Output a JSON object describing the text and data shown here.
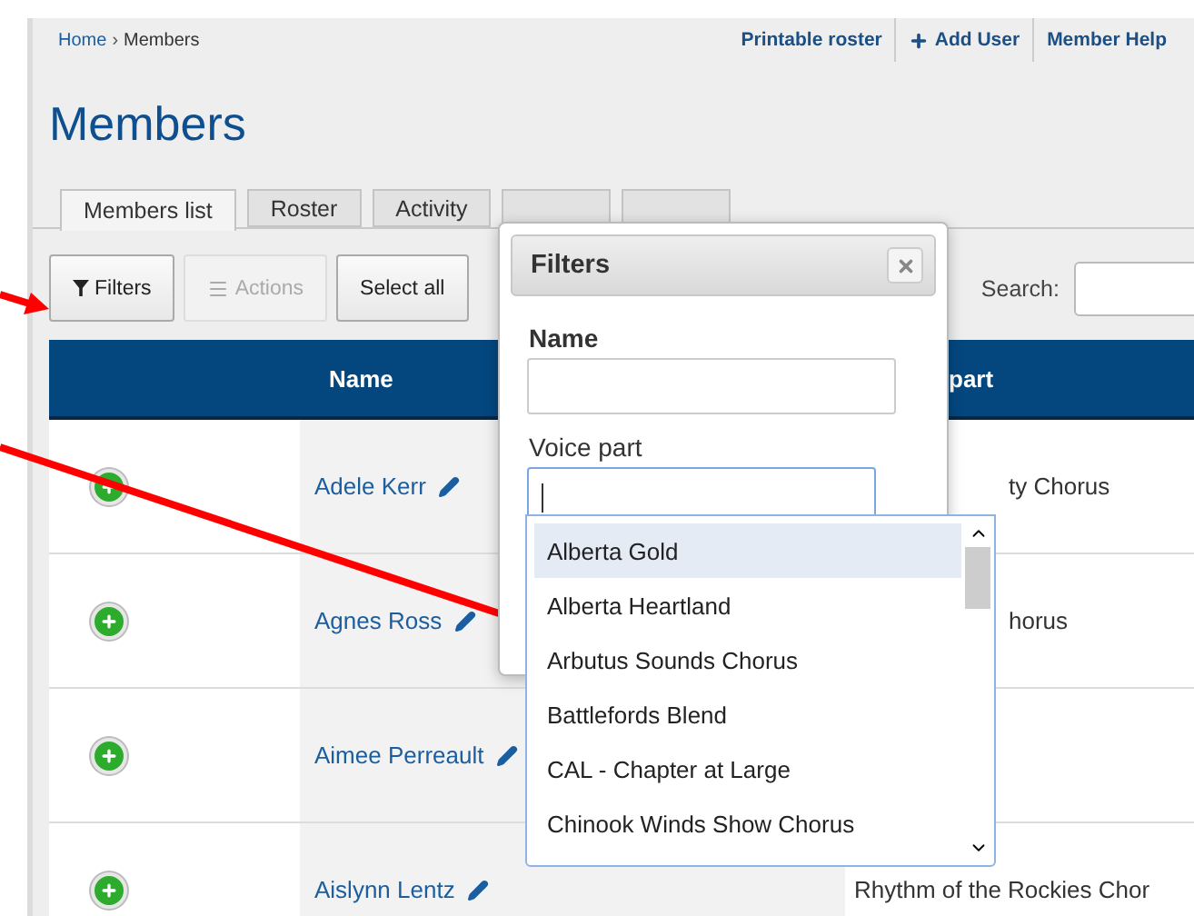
{
  "breadcrumb": {
    "separator": "›",
    "items": [
      {
        "label": "Home",
        "link": true
      },
      {
        "label": "Members",
        "link": false
      }
    ]
  },
  "header_links": [
    {
      "label": "Printable roster",
      "kind": "plain"
    },
    {
      "label": "Add User",
      "kind": "add"
    },
    {
      "label": "Member Help",
      "kind": "plain"
    }
  ],
  "page_title": "Members",
  "tabs": [
    {
      "label": "Members list",
      "selected": true
    },
    {
      "label": "Roster",
      "selected": false
    },
    {
      "label": "Activity",
      "selected": false
    },
    {
      "selected": false
    },
    {
      "selected": false
    }
  ],
  "toolbar": [
    {
      "label": "Filters",
      "kind": "filter",
      "disabled": false
    },
    {
      "label": "Actions",
      "kind": "actions",
      "disabled": true
    },
    {
      "label": "Select all",
      "kind": "plain",
      "disabled": false
    }
  ],
  "search": {
    "label": "Search:"
  },
  "table": {
    "name_column": "Name",
    "voice_column": "part",
    "rows": [
      {
        "name": "Adele Kerr",
        "voice_part": "ty Chorus"
      },
      {
        "name": "Agnes Ross",
        "voice_part": "horus"
      },
      {
        "name": "Aimee Perreault"
      },
      {
        "name": "Aislynn Lentz",
        "voice_part": "Rhythm of the Rockies Chor"
      }
    ]
  },
  "filters_dialog": {
    "title": "Filters",
    "name_label": "Name",
    "voice_label": "Voice part",
    "dropdown_open": true,
    "options": [
      {
        "label": "Alberta Gold",
        "selected": true
      },
      {
        "label": "Alberta Heartland",
        "selected": false
      },
      {
        "label": "Arbutus Sounds Chorus",
        "selected": false
      },
      {
        "label": "Battlefords Blend",
        "selected": false
      },
      {
        "label": "CAL - Chapter at Large",
        "selected": false
      },
      {
        "label": "Chinook Winds Show Chorus",
        "selected": false
      }
    ]
  }
}
